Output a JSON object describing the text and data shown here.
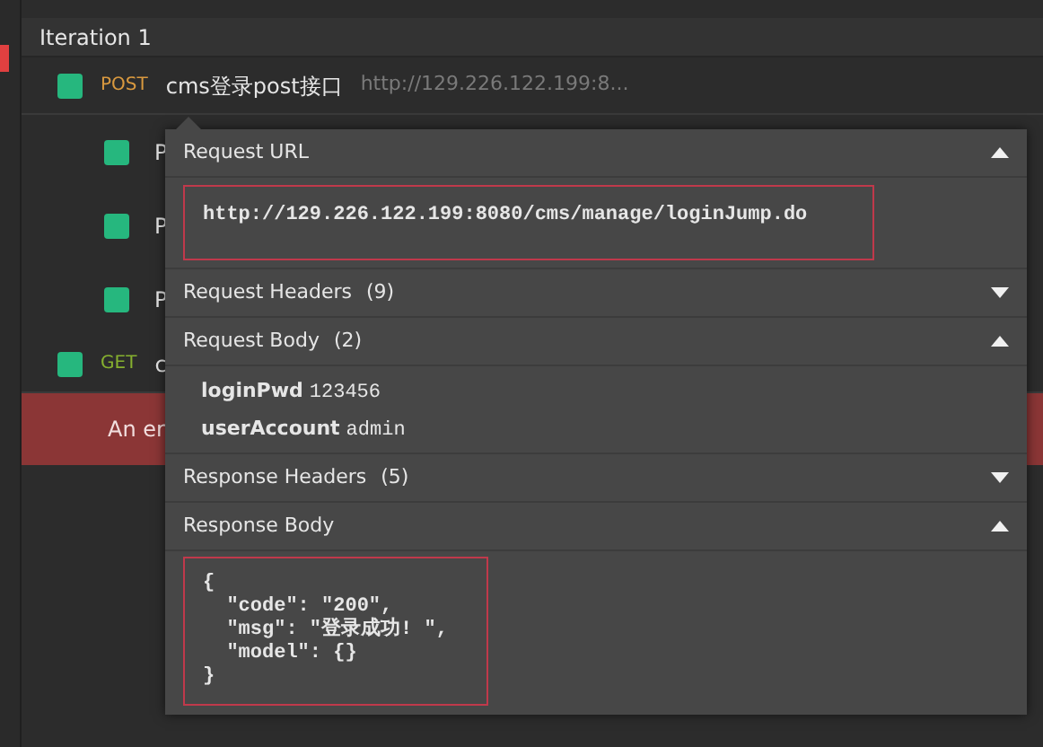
{
  "iteration": {
    "title": "Iteration 1"
  },
  "requests": [
    {
      "method": "POST",
      "color": "#d9993f",
      "name": "cms登录post接口",
      "url": "http://129.226.122.199:8...",
      "children": [
        {
          "name": "P"
        },
        {
          "name": "P"
        },
        {
          "name": "P"
        }
      ]
    },
    {
      "method": "GET",
      "color": "#86b02f",
      "name": "c"
    }
  ],
  "error": {
    "text": "An er"
  },
  "popover": {
    "sections": [
      {
        "kind": "url",
        "title": "Request URL",
        "expanded": true,
        "content": "http://129.226.122.199:8080/cms/manage/loginJump.do"
      },
      {
        "kind": "list",
        "title": "Request Headers",
        "count": "(9)",
        "expanded": false
      },
      {
        "kind": "params",
        "title": "Request Body",
        "count": "(2)",
        "expanded": true,
        "params": [
          {
            "key": "loginPwd",
            "value": "123456"
          },
          {
            "key": "userAccount",
            "value": "admin"
          }
        ]
      },
      {
        "kind": "list",
        "title": "Response Headers",
        "count": "(5)",
        "expanded": false
      },
      {
        "kind": "code",
        "title": "Response Body",
        "expanded": true,
        "content": "{\n  \"code\": \"200\",\n  \"msg\": \"登录成功! \",\n  \"model\": {}\n}"
      }
    ]
  }
}
